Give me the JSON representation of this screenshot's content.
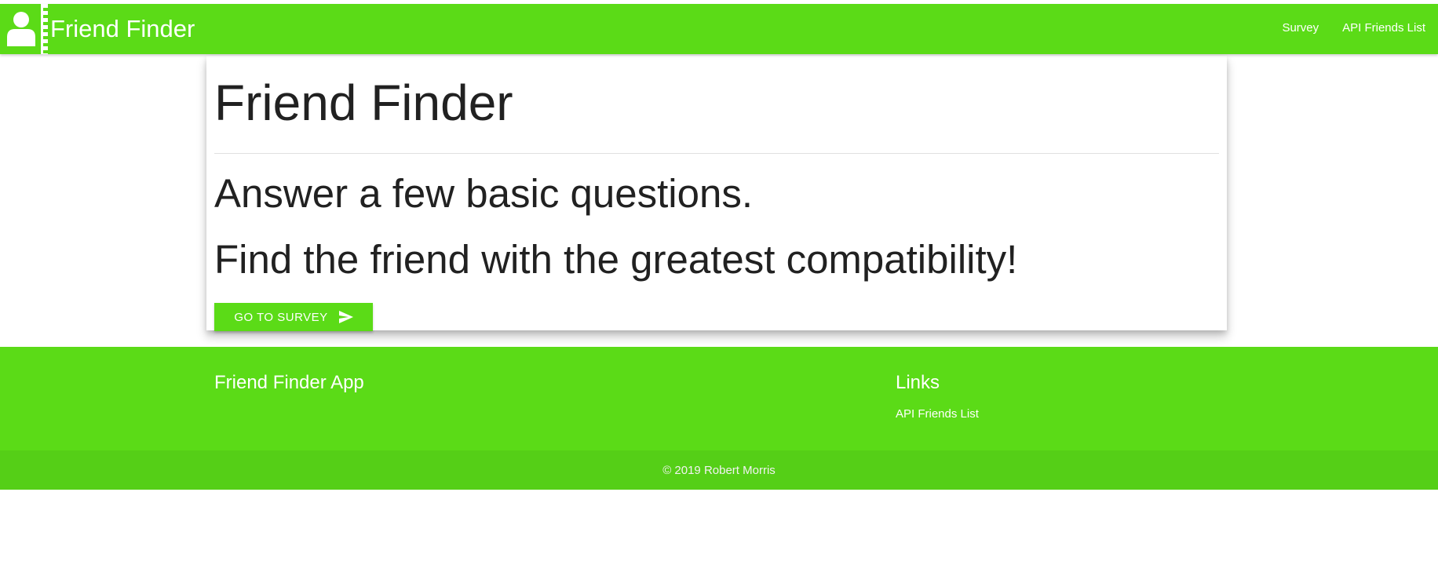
{
  "navbar": {
    "brand": "Friend Finder",
    "links": [
      "Survey",
      "API Friends List"
    ]
  },
  "card": {
    "title": "Friend Finder",
    "line1": "Answer a few basic questions.",
    "line2": "Find the friend with the greatest compatibility!",
    "button_label": "GO TO SURVEY"
  },
  "footer": {
    "app_title": "Friend Finder App",
    "links_title": "Links",
    "links": [
      "API Friends List"
    ],
    "copyright": "© 2019 Robert Morris"
  },
  "icons": {
    "logo": "person-icon",
    "button": "send-icon"
  },
  "colors": {
    "accent": "#5bdb17",
    "footer_copyright_bg": "#55cf17",
    "text": "#212121"
  }
}
